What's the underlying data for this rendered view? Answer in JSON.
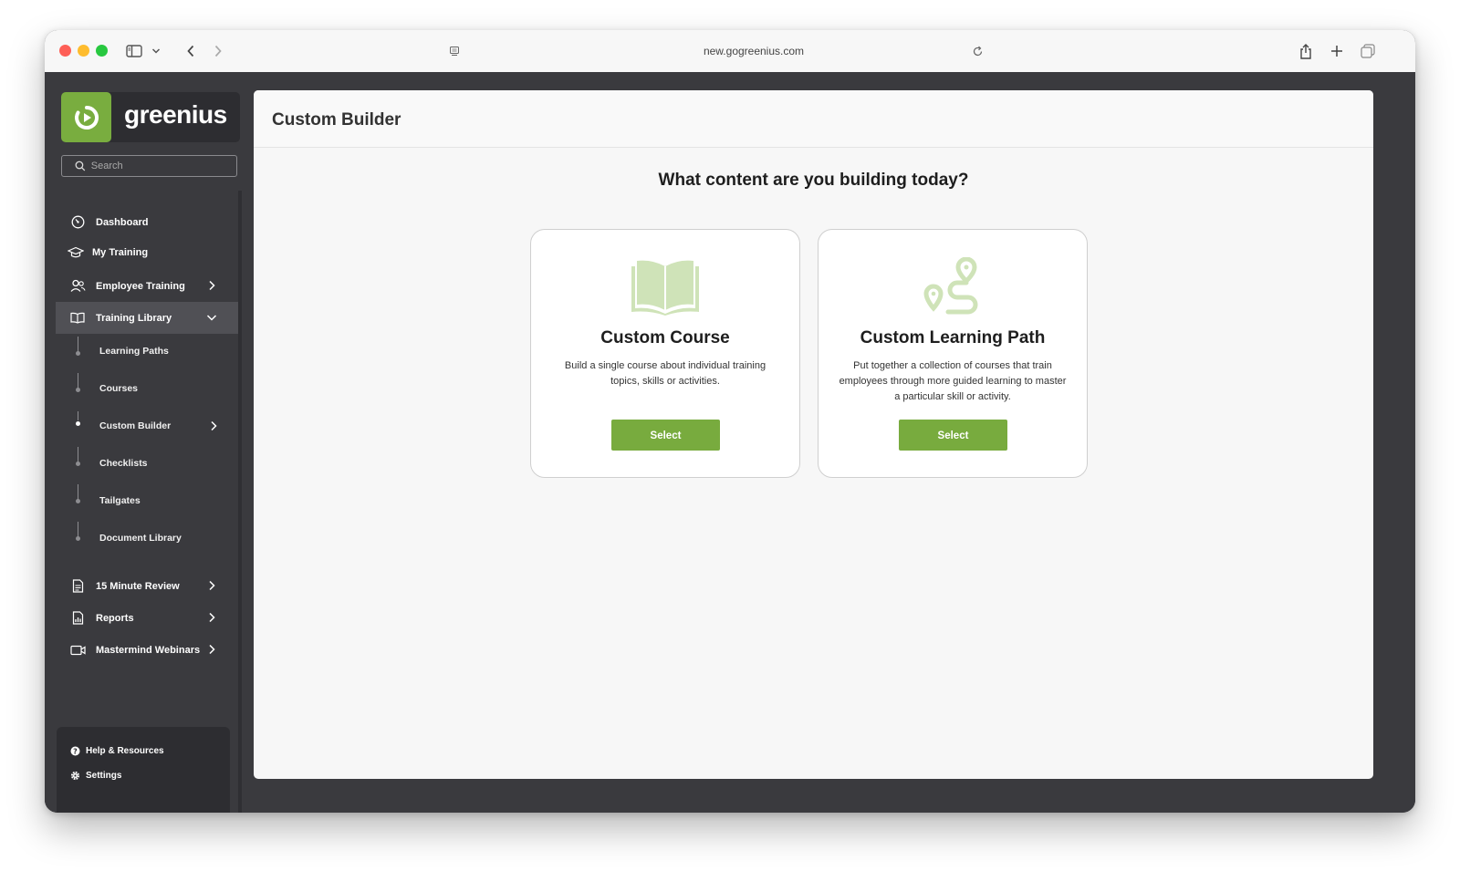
{
  "browser": {
    "url": "new.gogreenius.com"
  },
  "brand": {
    "name": "greenius"
  },
  "sidebar": {
    "search_placeholder": "Search",
    "items": [
      {
        "label": "Dashboard"
      },
      {
        "label": "My Training"
      },
      {
        "label": "Employee Training"
      },
      {
        "label": "Training Library"
      }
    ],
    "library_items": [
      {
        "label": "Learning Paths"
      },
      {
        "label": "Courses"
      },
      {
        "label": "Custom Builder"
      },
      {
        "label": "Checklists"
      },
      {
        "label": "Tailgates"
      },
      {
        "label": "Document Library"
      }
    ],
    "lower_items": [
      {
        "label": "15 Minute Review"
      },
      {
        "label": "Reports"
      },
      {
        "label": "Mastermind Webinars"
      }
    ],
    "bottom": {
      "help": "Help & Resources",
      "settings": "Settings"
    }
  },
  "main": {
    "title": "Custom Builder",
    "question": "What content are you building today?",
    "cards": [
      {
        "title": "Custom Course",
        "description": "Build a single course about individual training topics, skills or activities.",
        "button": "Select",
        "icon": "book-icon"
      },
      {
        "title": "Custom Learning Path",
        "description": "Put together a collection of courses that train employees through more guided learning to master a particular skill or activity.",
        "button": "Select",
        "icon": "route-icon"
      }
    ]
  },
  "colors": {
    "brand_green": "#79ad3f",
    "button_green": "#78ab3e",
    "icon_green_light": "#cfe3b8",
    "sidebar_bg": "#3a3a3e",
    "sidebar_active": "#505055"
  }
}
